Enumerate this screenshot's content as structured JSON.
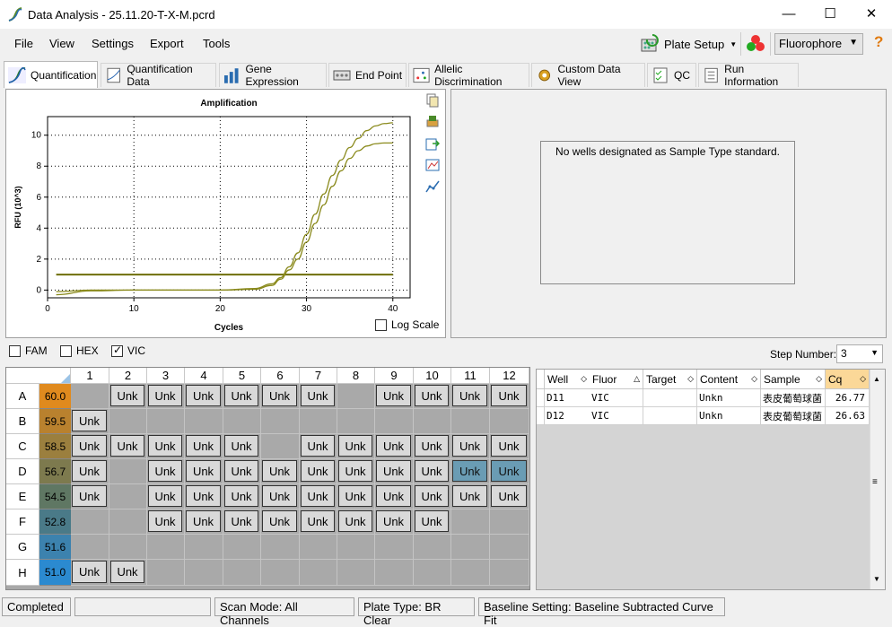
{
  "window": {
    "title": "Data Analysis - 25.11.20-T-X-M.pcrd",
    "minimize": "—",
    "maximize": "☐",
    "close": "✕"
  },
  "menu": [
    "File",
    "View",
    "Settings",
    "Export",
    "Tools"
  ],
  "toolbar": {
    "plate_setup": "Plate Setup",
    "fluorophore": "Fluorophore",
    "help": "?"
  },
  "tabs": [
    "Quantification",
    "Quantification Data",
    "Gene Expression",
    "End Point",
    "Allelic Discrimination",
    "Custom Data View",
    "QC",
    "Run Information"
  ],
  "chart": {
    "log_scale": "Log Scale"
  },
  "chart_data": {
    "type": "line",
    "title": "Amplification",
    "xlabel": "Cycles",
    "ylabel": "RFU (10^3)",
    "xlim": [
      0,
      42
    ],
    "ylim": [
      -0.5,
      11.2
    ],
    "xticks": [
      0,
      10,
      20,
      30,
      40
    ],
    "yticks": [
      0,
      2,
      4,
      6,
      8,
      10
    ],
    "grid": true,
    "series": [
      {
        "x": [
          1,
          5,
          10,
          15,
          20,
          24,
          26,
          27,
          28,
          29,
          30,
          31,
          32,
          33,
          34,
          35,
          36,
          37,
          38,
          39,
          40
        ],
        "values": [
          -0.1,
          0,
          0,
          0,
          0,
          0.1,
          0.4,
          0.8,
          1.5,
          2.4,
          3.6,
          4.9,
          6.2,
          7.4,
          8.4,
          9.2,
          9.8,
          10.3,
          10.6,
          10.75,
          10.8
        ]
      },
      {
        "x": [
          1,
          5,
          10,
          15,
          20,
          24,
          26,
          27,
          28,
          29,
          30,
          31,
          32,
          33,
          34,
          35,
          36,
          37,
          38,
          39,
          40
        ],
        "values": [
          -0.3,
          -0.05,
          0,
          0,
          0,
          0.05,
          0.3,
          0.7,
          1.3,
          2.0,
          3.1,
          4.3,
          5.5,
          6.7,
          7.7,
          8.5,
          9.0,
          9.3,
          9.45,
          9.5,
          9.5
        ]
      }
    ],
    "threshold": 1.0,
    "line_color": "#8a8a1c",
    "threshold_color": "#6e6e00"
  },
  "standard_message": "No wells designated as Sample Type standard.",
  "fluors": [
    {
      "label": "FAM",
      "checked": false
    },
    {
      "label": "HEX",
      "checked": false
    },
    {
      "label": "VIC",
      "checked": true
    }
  ],
  "step": {
    "label": "Step Number:",
    "value": "3"
  },
  "plate": {
    "columns": [
      "1",
      "2",
      "3",
      "4",
      "5",
      "6",
      "7",
      "8",
      "9",
      "10",
      "11",
      "12"
    ],
    "rows": [
      {
        "label": "A",
        "temp": "60.0",
        "color": "#e08a1e",
        "wells": [
          "",
          "Unk",
          "Unk",
          "Unk",
          "Unk",
          "Unk",
          "Unk",
          "",
          "Unk",
          "Unk",
          "Unk",
          "Unk"
        ]
      },
      {
        "label": "B",
        "temp": "59.5",
        "color": "#b9812e",
        "wells": [
          "Unk",
          "",
          "",
          "",
          "",
          "",
          "",
          "",
          "",
          "",
          "",
          ""
        ]
      },
      {
        "label": "C",
        "temp": "58.5",
        "color": "#9b7f3e",
        "wells": [
          "Unk",
          "Unk",
          "Unk",
          "Unk",
          "Unk",
          "",
          "Unk",
          "Unk",
          "Unk",
          "Unk",
          "Unk",
          "Unk"
        ]
      },
      {
        "label": "D",
        "temp": "56.7",
        "color": "#7d7a4e",
        "wells": [
          "Unk",
          "",
          "Unk",
          "Unk",
          "Unk",
          "Unk",
          "Unk",
          "Unk",
          "Unk",
          "Unk",
          "Unk*",
          "Unk*"
        ]
      },
      {
        "label": "E",
        "temp": "54.5",
        "color": "#5f7763",
        "wells": [
          "Unk",
          "",
          "Unk",
          "Unk",
          "Unk",
          "Unk",
          "Unk",
          "Unk",
          "Unk",
          "Unk",
          "Unk",
          "Unk"
        ]
      },
      {
        "label": "F",
        "temp": "52.8",
        "color": "#4a7a88",
        "wells": [
          "",
          "",
          "Unk",
          "Unk",
          "Unk",
          "Unk",
          "Unk",
          "Unk",
          "Unk",
          "Unk",
          "",
          ""
        ]
      },
      {
        "label": "G",
        "temp": "51.6",
        "color": "#3c82ae",
        "wells": [
          "",
          "",
          "",
          "",
          "",
          "",
          "",
          "",
          "",
          "",
          "",
          ""
        ]
      },
      {
        "label": "H",
        "temp": "51.0",
        "color": "#2b8ad0",
        "wells": [
          "Unk",
          "Unk",
          "",
          "",
          "",
          "",
          "",
          "",
          "",
          "",
          "",
          ""
        ]
      }
    ]
  },
  "results": {
    "headers": [
      "Well",
      "Fluor",
      "Target",
      "Content",
      "Sample",
      "Cq"
    ],
    "rows": [
      {
        "well": "D11",
        "fluor": "VIC",
        "target": "",
        "content": "Unkn",
        "sample": "表皮葡萄球菌",
        "cq": "26.77"
      },
      {
        "well": "D12",
        "fluor": "VIC",
        "target": "",
        "content": "Unkn",
        "sample": "表皮葡萄球菌",
        "cq": "26.63"
      }
    ]
  },
  "status": {
    "state": "Completed",
    "scan_mode": "Scan Mode: All Channels",
    "plate_type": "Plate Type: BR Clear",
    "baseline": "Baseline Setting: Baseline Subtracted Curve Fit"
  }
}
